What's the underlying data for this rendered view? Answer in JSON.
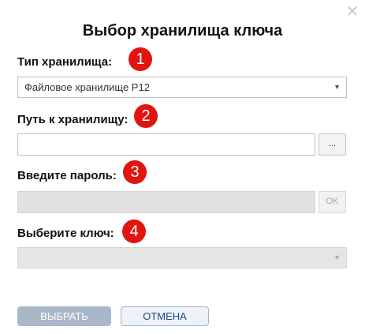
{
  "dialog": {
    "title": "Выбор хранилища ключа",
    "close_glyph": "✕"
  },
  "storage_type": {
    "label": "Тип хранилища:",
    "selected": "Файловое хранилище P12",
    "badge": "1"
  },
  "storage_path": {
    "label": "Путь к хранилищу:",
    "value": "",
    "browse_label": "...",
    "badge": "2"
  },
  "password": {
    "label": "Введите пароль:",
    "value": "",
    "ok_label": "OK",
    "badge": "3"
  },
  "key_select": {
    "label": "Выберите ключ:",
    "selected": "",
    "badge": "4"
  },
  "buttons": {
    "select_label": "ВЫБРАТЬ",
    "cancel_label": "ОТМЕНА"
  },
  "icons": {
    "caret": "▼"
  },
  "colors": {
    "badge": "#e1140f",
    "primary_button": "#a9b8c9",
    "cancel_text": "#1e4d87"
  }
}
